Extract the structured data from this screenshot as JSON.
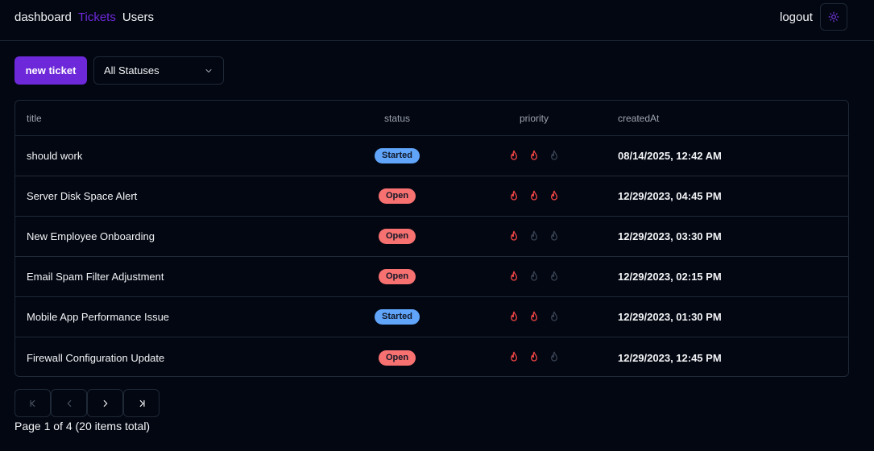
{
  "nav": {
    "items": [
      {
        "label": "dashboard",
        "active": false
      },
      {
        "label": "Tickets",
        "active": true
      },
      {
        "label": "Users",
        "active": false
      }
    ],
    "logout_label": "logout",
    "theme_icon": "sun-icon"
  },
  "toolbar": {
    "new_ticket_label": "new ticket",
    "status_filter_value": "All Statuses",
    "status_filter_icon": "chevron-down-icon"
  },
  "table": {
    "columns": [
      "title",
      "status",
      "priority",
      "createdAt"
    ],
    "priority_max": 3,
    "rows": [
      {
        "title": "should work",
        "status": "Started",
        "priority": 2,
        "createdAt": "08/14/2025, 12:42 AM"
      },
      {
        "title": "Server Disk Space Alert",
        "status": "Open",
        "priority": 3,
        "createdAt": "12/29/2023, 04:45 PM"
      },
      {
        "title": "New Employee Onboarding",
        "status": "Open",
        "priority": 1,
        "createdAt": "12/29/2023, 03:30 PM"
      },
      {
        "title": "Email Spam Filter Adjustment",
        "status": "Open",
        "priority": 1,
        "createdAt": "12/29/2023, 02:15 PM"
      },
      {
        "title": "Mobile App Performance Issue",
        "status": "Started",
        "priority": 2,
        "createdAt": "12/29/2023, 01:30 PM"
      },
      {
        "title": "Firewall Configuration Update",
        "status": "Open",
        "priority": 2,
        "createdAt": "12/29/2023, 12:45 PM"
      }
    ]
  },
  "pagination": {
    "buttons": [
      {
        "icon": "first-page-icon",
        "enabled": false
      },
      {
        "icon": "previous-page-icon",
        "enabled": false
      },
      {
        "icon": "next-page-icon",
        "enabled": true
      },
      {
        "icon": "last-page-icon",
        "enabled": true
      }
    ],
    "info": "Page 1 of 4 (20 items total)"
  },
  "colors": {
    "background": "#030712",
    "accent": "#6d28d9",
    "border": "#1f2937",
    "status_started": "#60a5fa",
    "status_open": "#f87171",
    "flame_active": "#ef4444",
    "flame_inactive": "#374151"
  }
}
